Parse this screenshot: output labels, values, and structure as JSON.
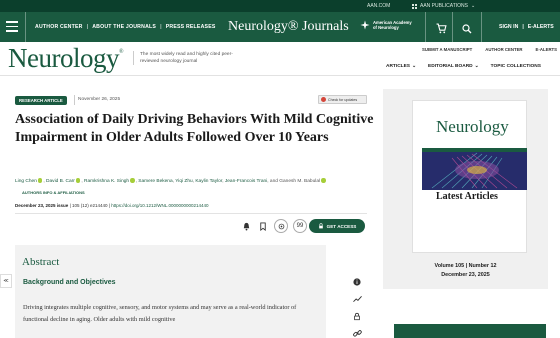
{
  "top_strip": {
    "aan_com": "AAN.COM",
    "aan_publications": "AAN PUBLICATIONS"
  },
  "nav": {
    "links": [
      "AUTHOR CENTER",
      "ABOUT THE JOURNALS",
      "PRESS RELEASES"
    ],
    "brand": "Neurology® Journals",
    "aan_logo_text": "American Academy of Neurology",
    "sign_in": "SIGN IN",
    "e_alerts": "E-ALERTS"
  },
  "journal_header": {
    "logo": "Neurology",
    "tagline": "The most widely read and highly cited peer-reviewed neurology journal",
    "links_top": [
      "SUBMIT A MANUSCRIPT",
      "AUTHOR CENTER",
      "E-ALERTS"
    ],
    "links_main": [
      "ARTICLES",
      "EDITORIAL BOARD",
      "TOPIC COLLECTIONS"
    ]
  },
  "article": {
    "badge": "RESEARCH ARTICLE",
    "date": "November 26, 2025",
    "check_updates": "Check for updates",
    "title": "Association of Daily Driving Behaviors With Mild Cognitive Impairment in Older Adults Followed Over 10 Years",
    "authors": [
      "Ling Chen",
      "David B. Carr",
      "Ramkrishna K. Singh",
      "Samere Bekena",
      "Yiqi Zhu",
      "Kaylin Taylor",
      "Jean-Francois Trani"
    ],
    "authors_tail": ", and Ganesh M. Babulal",
    "affiliations": "AUTHORS INFO & AFFILIATIONS",
    "issue_date": "December 23, 2025 issue",
    "volume": "105 (12) e214440",
    "doi": "https://doi.org/10.1212/WNL.0000000000214440",
    "quote_icon": "99",
    "get_access": "GET ACCESS"
  },
  "abstract": {
    "heading": "Abstract",
    "subheading": "Background and Objectives",
    "text": "Driving integrates multiple cognitive, sensory, and motor systems and may serve as a real-world indicator of functional decline in aging. Older adults with mild cognitive"
  },
  "sidebar": {
    "cover_logo": "Neurology",
    "latest": "Latest Articles",
    "volume_line": "Volume 105 | Number 12",
    "date_line": "December 23, 2025"
  },
  "colors": {
    "brand_green": "#1a5a40",
    "dark_green": "#0b3f2c",
    "orcid": "#a6ce39"
  },
  "icons": [
    "menu-icon",
    "cart-icon",
    "search-icon",
    "chevron-down-icon",
    "bell-icon",
    "bookmark-icon",
    "share-icon",
    "lock-icon",
    "info-icon",
    "trend-icon",
    "link-icon"
  ]
}
